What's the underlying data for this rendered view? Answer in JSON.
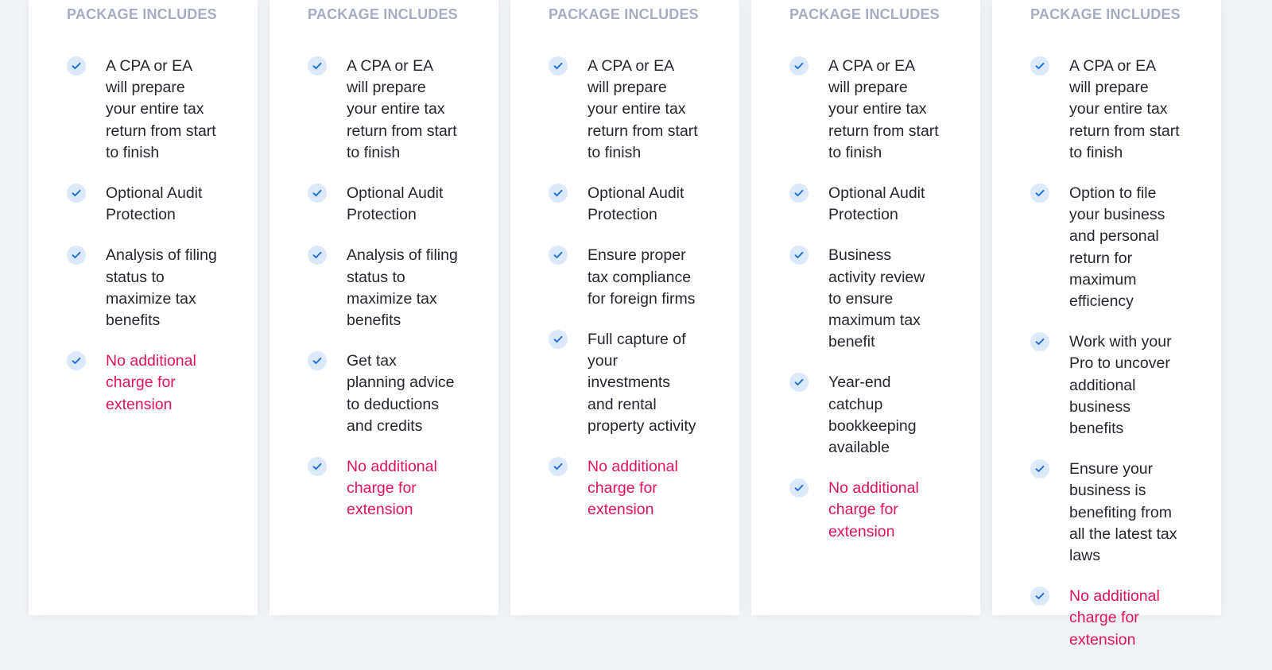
{
  "colors": {
    "page_background": "#f1f3f6",
    "card_background": "#ffffff",
    "heading": "#a7adc0",
    "text": "#26272e",
    "highlight": "#e01260",
    "check_bg": "#dce9fb",
    "check_mark": "#1f6fd6"
  },
  "cards": [
    {
      "heading": "PACKAGE INCLUDES",
      "features": [
        {
          "icon": "check-icon",
          "text": "A CPA or EA will prepare your entire tax return from start to finish",
          "highlight": false
        },
        {
          "icon": "check-icon",
          "text": "Optional Audit Protection",
          "highlight": false
        },
        {
          "icon": "check-icon",
          "text": "Analysis of filing status to maximize tax benefits",
          "highlight": false
        },
        {
          "icon": "check-icon",
          "text": "No additional charge for extension",
          "highlight": true
        }
      ]
    },
    {
      "heading": "PACKAGE INCLUDES",
      "features": [
        {
          "icon": "check-icon",
          "text": "A CPA or EA will prepare your entire tax return from start to finish",
          "highlight": false
        },
        {
          "icon": "check-icon",
          "text": "Optional Audit Protection",
          "highlight": false
        },
        {
          "icon": "check-icon",
          "text": "Analysis of filing status to maximize tax benefits",
          "highlight": false
        },
        {
          "icon": "check-icon",
          "text": "Get tax planning advice to deductions and credits",
          "highlight": false
        },
        {
          "icon": "check-icon",
          "text": "No additional charge for extension",
          "highlight": true
        }
      ]
    },
    {
      "heading": "PACKAGE INCLUDES",
      "features": [
        {
          "icon": "check-icon",
          "text": "A CPA or EA will prepare your entire tax return from start to finish",
          "highlight": false
        },
        {
          "icon": "check-icon",
          "text": "Optional Audit Protection",
          "highlight": false
        },
        {
          "icon": "check-icon",
          "text": "Ensure proper tax compliance for foreign firms",
          "highlight": false
        },
        {
          "icon": "check-icon",
          "text": "Full capture of your investments and rental property activity",
          "highlight": false
        },
        {
          "icon": "check-icon",
          "text": "No additional charge for extension",
          "highlight": true
        }
      ]
    },
    {
      "heading": "PACKAGE INCLUDES",
      "features": [
        {
          "icon": "check-icon",
          "text": "A CPA or EA will prepare your entire tax return from start to finish",
          "highlight": false
        },
        {
          "icon": "check-icon",
          "text": "Optional Audit Protection",
          "highlight": false
        },
        {
          "icon": "check-icon",
          "text": "Business activity review to ensure maximum tax benefit",
          "highlight": false
        },
        {
          "icon": "check-icon",
          "text": "Year-end catchup bookkeeping available",
          "highlight": false
        },
        {
          "icon": "check-icon",
          "text": "No additional charge for extension",
          "highlight": true
        }
      ]
    },
    {
      "heading": "PACKAGE INCLUDES",
      "features": [
        {
          "icon": "check-icon",
          "text": "A CPA or EA will prepare your entire tax return from start to finish",
          "highlight": false
        },
        {
          "icon": "check-icon",
          "text": "Option to file your business and personal return for maximum efficiency",
          "highlight": false
        },
        {
          "icon": "check-icon",
          "text": "Work with your Pro to uncover additional business benefits",
          "highlight": false
        },
        {
          "icon": "check-icon",
          "text": "Ensure your business is benefiting from all the latest tax laws",
          "highlight": false
        },
        {
          "icon": "check-icon",
          "text": "No additional charge for extension",
          "highlight": true
        }
      ]
    }
  ]
}
